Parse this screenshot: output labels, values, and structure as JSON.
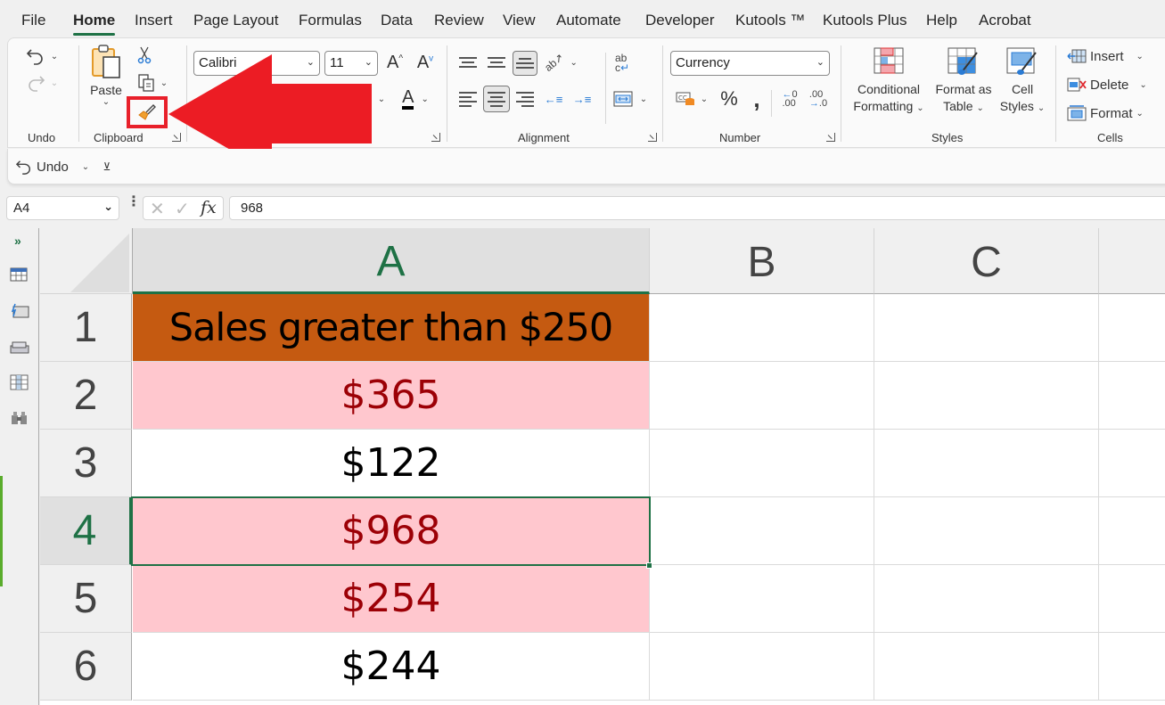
{
  "menu": {
    "tabs": [
      {
        "label": "File",
        "active": false
      },
      {
        "label": "Home",
        "active": true
      },
      {
        "label": "Insert",
        "active": false
      },
      {
        "label": "Page Layout",
        "active": false
      },
      {
        "label": "Formulas",
        "active": false
      },
      {
        "label": "Data",
        "active": false
      },
      {
        "label": "Review",
        "active": false
      },
      {
        "label": "View",
        "active": false
      },
      {
        "label": "Automate",
        "active": false
      },
      {
        "label": "Developer",
        "active": false
      },
      {
        "label": "Kutools ™",
        "active": false
      },
      {
        "label": "Kutools Plus",
        "active": false
      },
      {
        "label": "Help",
        "active": false
      },
      {
        "label": "Acrobat",
        "active": false
      }
    ],
    "accent_color": "#1e7145"
  },
  "ribbon": {
    "groups": {
      "undo": "Undo",
      "clipboard": "Clipboard",
      "font": "",
      "alignment": "Alignment",
      "number": "Number",
      "styles": "Styles",
      "cells": "Cells"
    },
    "clipboard": {
      "paste_label": "Paste",
      "format_painter_highlight": "#e8202a"
    },
    "font": {
      "font_name": "Calibri",
      "font_size": "11"
    },
    "number": {
      "format": "Currency",
      "percent": "%",
      "comma": "ʼ",
      "inc_decimal": ".00",
      "dec_decimal": ".0"
    },
    "styles": {
      "conditional_formatting": [
        "Conditional",
        "Formatting"
      ],
      "format_as_table": [
        "Format as",
        "Table"
      ],
      "cell_styles": [
        "Cell",
        "Styles"
      ]
    },
    "cells": {
      "insert": "Insert",
      "delete": "Delete",
      "format": "Format"
    }
  },
  "annotation": {
    "arrow_color": "#ec1c24",
    "points_to": "format-painter-button"
  },
  "quick_access": {
    "undo_label": "Undo"
  },
  "formula_bar": {
    "name_box": "A4",
    "formula": "968",
    "fx": "fx"
  },
  "sheet": {
    "columns": [
      "A",
      "B",
      "C"
    ],
    "selected_column": "A",
    "rows": [
      {
        "num": "1",
        "A": "Sales greater than $250",
        "style": "header"
      },
      {
        "num": "2",
        "A": "$365",
        "style": "highlight"
      },
      {
        "num": "3",
        "A": "$122",
        "style": "normal"
      },
      {
        "num": "4",
        "A": "$968",
        "style": "highlight"
      },
      {
        "num": "5",
        "A": "$254",
        "style": "highlight"
      },
      {
        "num": "6",
        "A": "$244",
        "style": "normal"
      }
    ],
    "selected_cell": "A4",
    "colors": {
      "header_fill": "#c55a11",
      "highlight_fill": "#ffc7ce",
      "highlight_text": "#9c0006"
    }
  }
}
